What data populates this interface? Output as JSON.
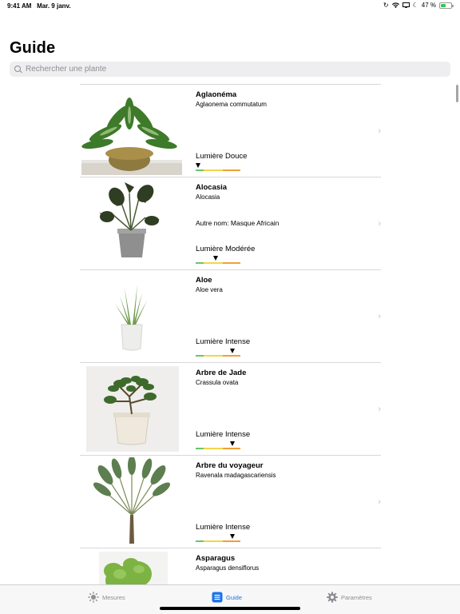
{
  "status": {
    "time": "9:41 AM",
    "date": "Mar. 9 janv.",
    "battery": "47 %",
    "battery_level": 0.47,
    "icons": [
      "rotation-lock-icon",
      "wifi-icon",
      "screen-mirroring-icon",
      "moon-icon",
      "battery-icon"
    ]
  },
  "header": {
    "title": "Guide"
  },
  "search": {
    "placeholder": "Rechercher une plante"
  },
  "colors": {
    "accent": "#1a73e8",
    "meter_low": "#6cc46c",
    "meter_mid": "#f2d64b",
    "meter_high": "#f0a03a"
  },
  "plants": [
    {
      "name": "Aglaonéma",
      "scientific": "Aglaonema commutatum",
      "other_name": "",
      "light": "Lumière Douce",
      "light_level": 0.05,
      "image": "aglaonema-photo"
    },
    {
      "name": "Alocasia",
      "scientific": "Alocasia",
      "other_name": "Autre nom: Masque Africain",
      "light": "Lumière Modérée",
      "light_level": 0.45,
      "image": "alocasia-photo"
    },
    {
      "name": "Aloe",
      "scientific": "Aloe vera",
      "other_name": "",
      "light": "Lumière Intense",
      "light_level": 0.82,
      "image": "aloe-photo"
    },
    {
      "name": "Arbre de Jade",
      "scientific": "Crassula ovata",
      "other_name": "",
      "light": "Lumière Intense",
      "light_level": 0.82,
      "image": "jade-photo"
    },
    {
      "name": "Arbre du voyageur",
      "scientific": "Ravenala madagascariensis",
      "other_name": "",
      "light": "Lumière Intense",
      "light_level": 0.82,
      "image": "ravenala-photo"
    },
    {
      "name": "Asparagus",
      "scientific": "Asparagus densiflorus",
      "other_name": "",
      "light": "",
      "light_level": null,
      "image": "asparagus-photo"
    }
  ],
  "tabs": [
    {
      "label": "Mesures",
      "icon": "sun-icon",
      "active": false
    },
    {
      "label": "Guide",
      "icon": "list-icon",
      "active": true
    },
    {
      "label": "Paramètres",
      "icon": "gear-icon",
      "active": false
    }
  ]
}
